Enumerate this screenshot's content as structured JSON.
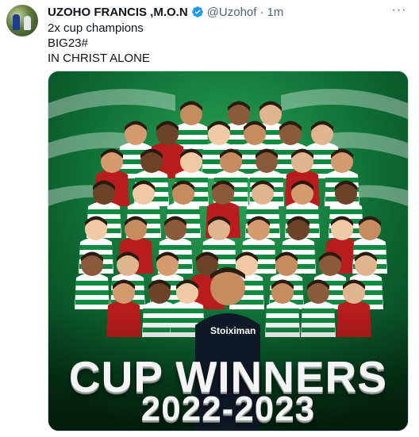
{
  "tweet": {
    "author_name": "UZOHO FRANCIS ,M.O.N",
    "handle": "@Uzohof",
    "separator": "·",
    "timestamp": "1m",
    "more_label": "···",
    "text_lines": [
      "2x cup champions",
      "BIG23#",
      "IN CHRIST ALONE"
    ]
  },
  "media": {
    "headline": "CUP WINNERS",
    "season": "2022-2023",
    "sponsor": "Stoiximan"
  },
  "colors": {
    "brand_green": "#0e7a3a",
    "verified_blue": "#1d9bf0",
    "muted_text": "#536471"
  },
  "icons": {
    "verified": "verified-badge-icon",
    "more": "more-options-icon"
  }
}
